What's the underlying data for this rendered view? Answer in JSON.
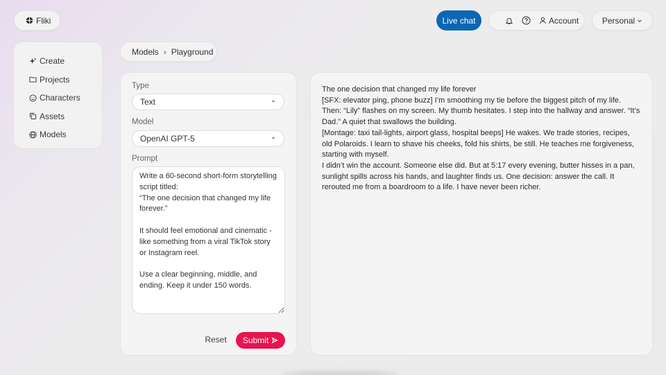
{
  "header": {
    "logo_label": "Fliki",
    "live_chat_label": "Live chat",
    "account_label": "Account",
    "workspace_label": "Personal"
  },
  "sidebar": {
    "items": [
      {
        "label": "Create",
        "icon": "sparkle-icon"
      },
      {
        "label": "Projects",
        "icon": "folder-icon"
      },
      {
        "label": "Characters",
        "icon": "smiley-icon"
      },
      {
        "label": "Assets",
        "icon": "stack-icon"
      },
      {
        "label": "Models",
        "icon": "globe-icon"
      }
    ]
  },
  "breadcrumb": {
    "parent": "Models",
    "separator": "›",
    "current": "Playground"
  },
  "form": {
    "type_label": "Type",
    "type_value": "Text",
    "model_label": "Model",
    "model_value": "OpenAI GPT-5",
    "prompt_label": "Prompt",
    "prompt_value": "Write a 60-second short-form storytelling script titled:\n“The one decision that changed my life forever.”\n\nIt should feel emotional and cinematic - like something from a viral TikTok story or Instagram reel.\n\nUse a clear beginning, middle, and ending. Keep it under 150 words.",
    "reset_label": "Reset",
    "submit_label": "Submit"
  },
  "output": {
    "lines": [
      "The one decision that changed my life forever",
      "[SFX: elevator ping, phone buzz] I’m smoothing my tie before the biggest pitch of my life. Then: “Lily” flashes on my screen. My thumb hesitates. I step into the hallway and answer. “It’s Dad.” A quiet that swallows the building.",
      "[Montage: taxi tail-lights, airport glass, hospital beeps] He wakes. We trade stories, recipes, old Polaroids. I learn to shave his cheeks, fold his shirts, be still. He teaches me forgiveness, starting with myself.",
      "I didn’t win the account. Someone else did. But at 5:17 every evening, butter hisses in a pan, sunlight spills across his hands, and laughter finds us. One decision: answer the call. It rerouted me from a boardroom to a life. I have never been richer."
    ]
  },
  "colors": {
    "live_chat_bg": "#0b66b3",
    "submit_bg": "#e8134f"
  }
}
